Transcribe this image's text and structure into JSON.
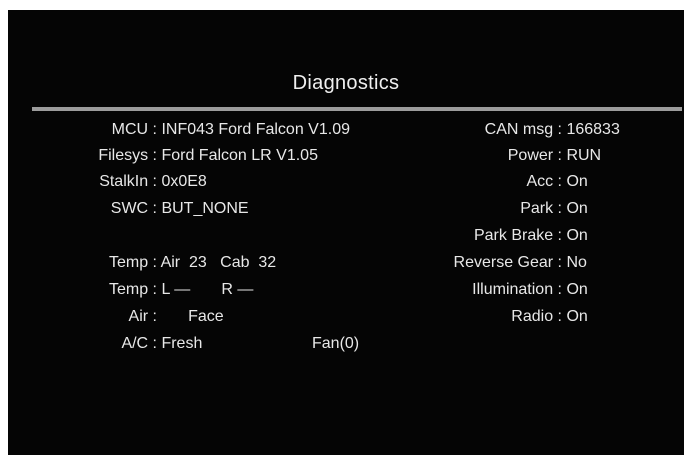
{
  "title": "Diagnostics",
  "left": [
    {
      "label": "MCU :",
      "value": " INF043 Ford Falcon V1.09"
    },
    {
      "label": "Filesys :",
      "value": " Ford Falcon LR V1.05"
    },
    {
      "label": "StalkIn :",
      "value": " 0x0E8"
    },
    {
      "label": "SWC :",
      "value": " BUT_NONE"
    },
    {
      "label": "Temp :",
      "value": " Air  23   Cab  32"
    },
    {
      "label": "Temp :",
      "value": " L —       R —"
    },
    {
      "label": "Air :",
      "value": "       Face"
    },
    {
      "label": "A/C :",
      "value": " Fresh"
    }
  ],
  "fan": "Fan(0)",
  "right": [
    {
      "label": "CAN msg :",
      "value": " 166833"
    },
    {
      "label": "Power :",
      "value": " RUN"
    },
    {
      "label": "Acc :",
      "value": " On"
    },
    {
      "label": "Park :",
      "value": " On"
    },
    {
      "label": "Park Brake :",
      "value": " On"
    },
    {
      "label": "Reverse Gear :",
      "value": " No"
    },
    {
      "label": "Illumination :",
      "value": " On"
    },
    {
      "label": "Radio :",
      "value": " On"
    }
  ]
}
